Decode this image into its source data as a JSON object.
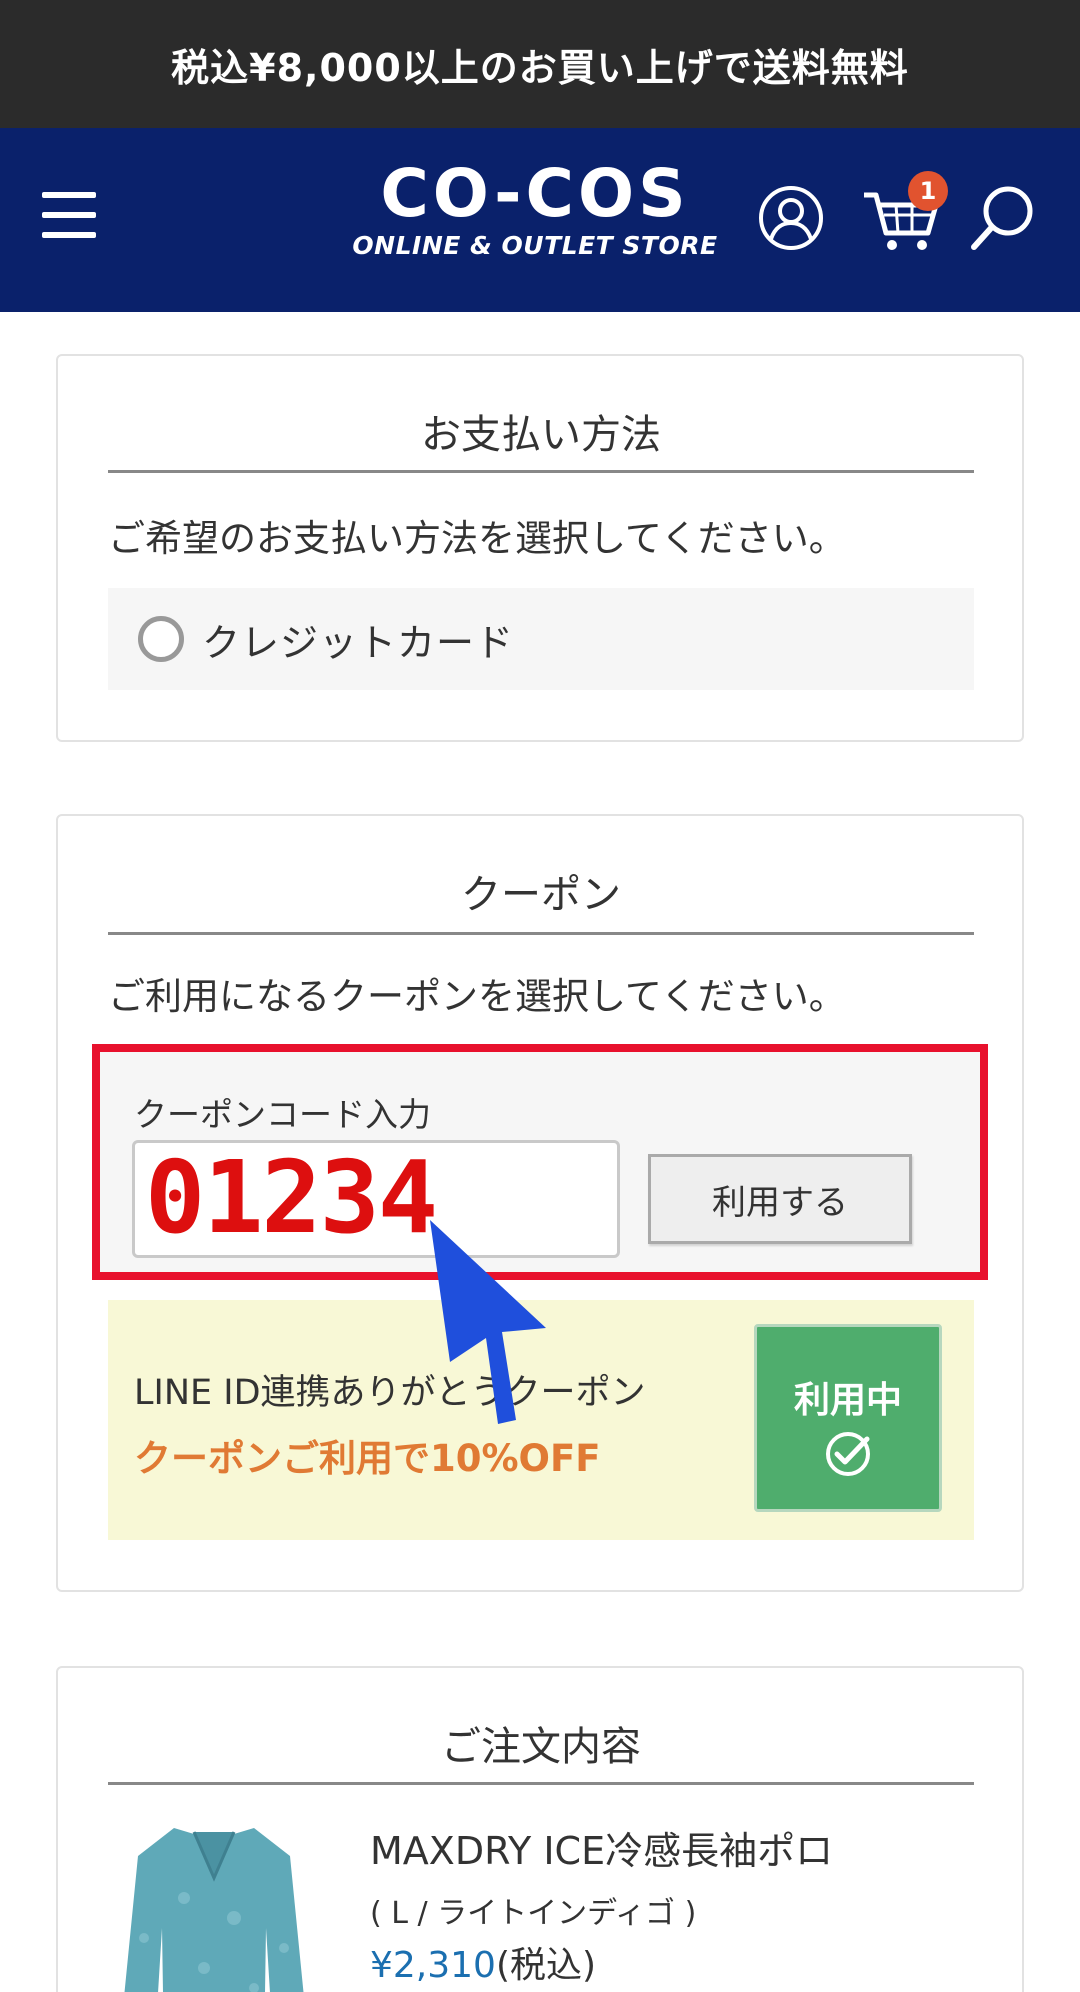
{
  "promo": {
    "text": "税込¥8,000以上のお買い上げで送料無料"
  },
  "header": {
    "logo_main": "CO-COS",
    "logo_sub": "ONLINE & OUTLET STORE",
    "cart_count": "1",
    "icons": [
      "menu-icon",
      "user-icon",
      "cart-icon",
      "search-icon"
    ],
    "background": "#0a216b"
  },
  "payment": {
    "title": "お支払い方法",
    "lead": "ご希望のお支払い方法を選択してください。",
    "options": [
      {
        "label": "クレジットカード",
        "selected": false
      }
    ]
  },
  "coupon": {
    "title": "クーポン",
    "lead": "ご利用になるクーポンを選択してください。",
    "code_label": "クーポンコード入力",
    "code_value": "01234",
    "apply_label": "利用する",
    "highlight_color": "#e8112d",
    "line_coupon": {
      "title": "LINE ID連携ありがとうクーポン",
      "subtitle": "クーポンご利用で10%OFF",
      "status_label": "利用中"
    }
  },
  "order": {
    "title": "ご注文内容",
    "items": [
      {
        "name": "MAXDRY ICE冷感長袖ポロ",
        "variant": "( L / ライトインディゴ )",
        "price": "¥2,310",
        "tax_note": "(税込)"
      }
    ]
  }
}
